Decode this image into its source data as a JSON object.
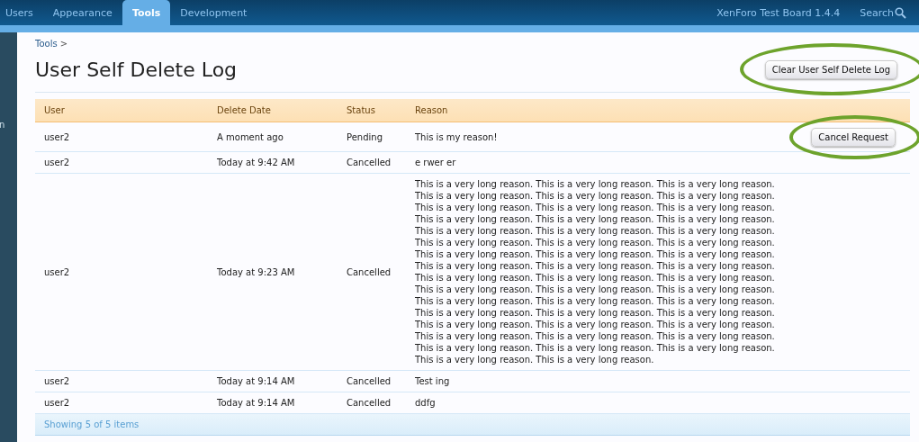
{
  "nav": {
    "tabs": [
      {
        "label": "Users",
        "selected": false
      },
      {
        "label": "Appearance",
        "selected": false
      },
      {
        "label": "Tools",
        "selected": true
      },
      {
        "label": "Development",
        "selected": false
      }
    ],
    "board_title": "XenForo Test Board 1.4.4",
    "search": "Search"
  },
  "sidebar": {
    "items": [
      "n"
    ]
  },
  "breadcrumb": {
    "link": "Tools",
    "separator": ">"
  },
  "title": "User Self Delete Log",
  "clear_button": "Clear User Self Delete Log",
  "table": {
    "columns": [
      "User",
      "Delete Date",
      "Status",
      "Reason"
    ],
    "rows": [
      {
        "user": "user2",
        "date": "A moment ago",
        "status": "Pending",
        "reason": "This is my reason!",
        "action": "Cancel Request"
      },
      {
        "user": "user2",
        "date": "Today at 9:42 AM",
        "status": "Cancelled",
        "reason": "e rwer er"
      },
      {
        "user": "user2",
        "date": "Today at 9:23 AM",
        "status": "Cancelled",
        "reason": "This is a very long reason. This is a very long reason. This is a very long reason. This is a very long reason. This is a very long reason. This is a very long reason. This is a very long reason. This is a very long reason. This is a very long reason. This is a very long reason. This is a very long reason. This is a very long reason. This is a very long reason. This is a very long reason. This is a very long reason. This is a very long reason. This is a very long reason. This is a very long reason. This is a very long reason. This is a very long reason. This is a very long reason. This is a very long reason. This is a very long reason. This is a very long reason. This is a very long reason. This is a very long reason. This is a very long reason. This is a very long reason. This is a very long reason. This is a very long reason. This is a very long reason. This is a very long reason. This is a very long reason. This is a very long reason. This is a very long reason. This is a very long reason. This is a very long reason. This is a very long reason. This is a very long reason. This is a very long reason. This is a very long reason. This is a very long reason. This is a very long reason. This is a very long reason. This is a very long reason. This is a very long reason. This is a very long reason."
      },
      {
        "user": "user2",
        "date": "Today at 9:14 AM",
        "status": "Cancelled",
        "reason": "Test ing"
      },
      {
        "user": "user2",
        "date": "Today at 9:14 AM",
        "status": "Cancelled",
        "reason": "ddfg"
      }
    ],
    "footer": "Showing 5 of 5 items"
  }
}
